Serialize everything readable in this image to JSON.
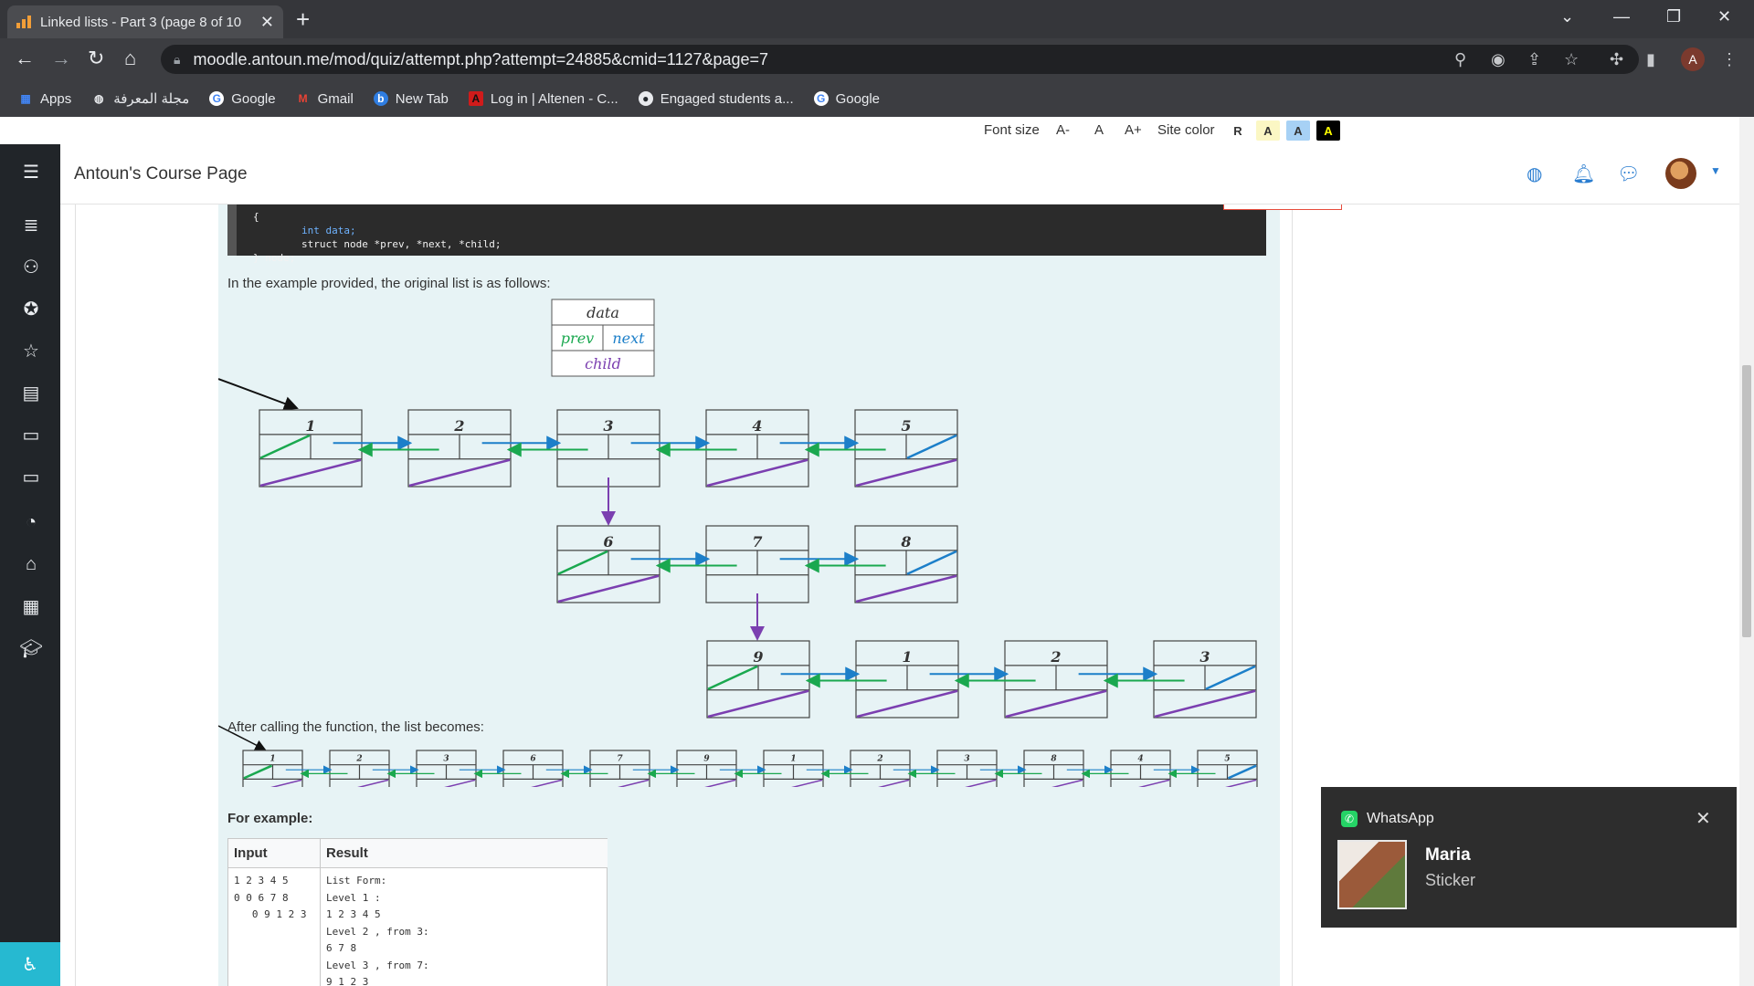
{
  "browser": {
    "tab_title": "Linked lists - Part 3 (page 8 of 10",
    "tab_close": "✕",
    "new_tab": "+",
    "url": "moodle.antoun.me/mod/quiz/attempt.php?attempt=24885&cmid=1127&page=7",
    "profile_initial": "A",
    "bookmarks": [
      {
        "label": "Apps",
        "icon": "apps-grid-icon"
      },
      {
        "label": "مجلة المعرفة",
        "icon": "globe-icon"
      },
      {
        "label": "Google",
        "icon": "google-icon"
      },
      {
        "label": "Gmail",
        "icon": "gmail-icon"
      },
      {
        "label": "New Tab",
        "icon": "newtab-icon"
      },
      {
        "label": "Log in | Altenen - C...",
        "icon": "altenen-icon"
      },
      {
        "label": "Engaged students a...",
        "icon": "github-icon"
      },
      {
        "label": "Google",
        "icon": "google-icon"
      }
    ]
  },
  "accessibility": {
    "font_size_label": "Font size",
    "font_smaller": "A-",
    "font_normal": "A",
    "font_larger": "A+",
    "site_color_label": "Site color",
    "color_reset": "R",
    "color_a1": "A",
    "color_a2": "A",
    "color_a3": "A"
  },
  "header": {
    "site_name": "Antoun's Course Page"
  },
  "question": {
    "code_lines": [
      "{",
      "        int data;",
      "        struct node *prev, *next, *child;",
      "} node;"
    ],
    "intro_text": "In the example provided, the original list is as follows:",
    "after_text": "After calling the function, the list becomes:",
    "for_example": "For example:",
    "legend": {
      "data": "data",
      "prev": "prev",
      "next": "next",
      "child": "child"
    },
    "original_list": {
      "level1": [
        "1",
        "2",
        "3",
        "4",
        "5"
      ],
      "level2": [
        "6",
        "7",
        "8"
      ],
      "level3": [
        "9",
        "1",
        "2",
        "3"
      ]
    },
    "flattened_list": [
      "1",
      "2",
      "3",
      "6",
      "7",
      "9",
      "1",
      "2",
      "3",
      "8",
      "4",
      "5"
    ],
    "examples_table": {
      "headers": [
        "Input",
        "Result"
      ],
      "input": "1 2 3 4 5\n0 0 6 7 8\n   0 9 1 2 3",
      "result": "List Form:\nLevel 1 :\n1 2 3 4 5\nLevel 2 , from 3:\n6 7 8\nLevel 3 , from 7:\n9 1 2 3"
    }
  },
  "toast": {
    "app": "WhatsApp",
    "sender": "Maria",
    "message": "Sticker"
  },
  "colors": {
    "prev_link": "#1aa84f",
    "next_link": "#1c7fc9",
    "child_link": "#7b3fb0"
  }
}
